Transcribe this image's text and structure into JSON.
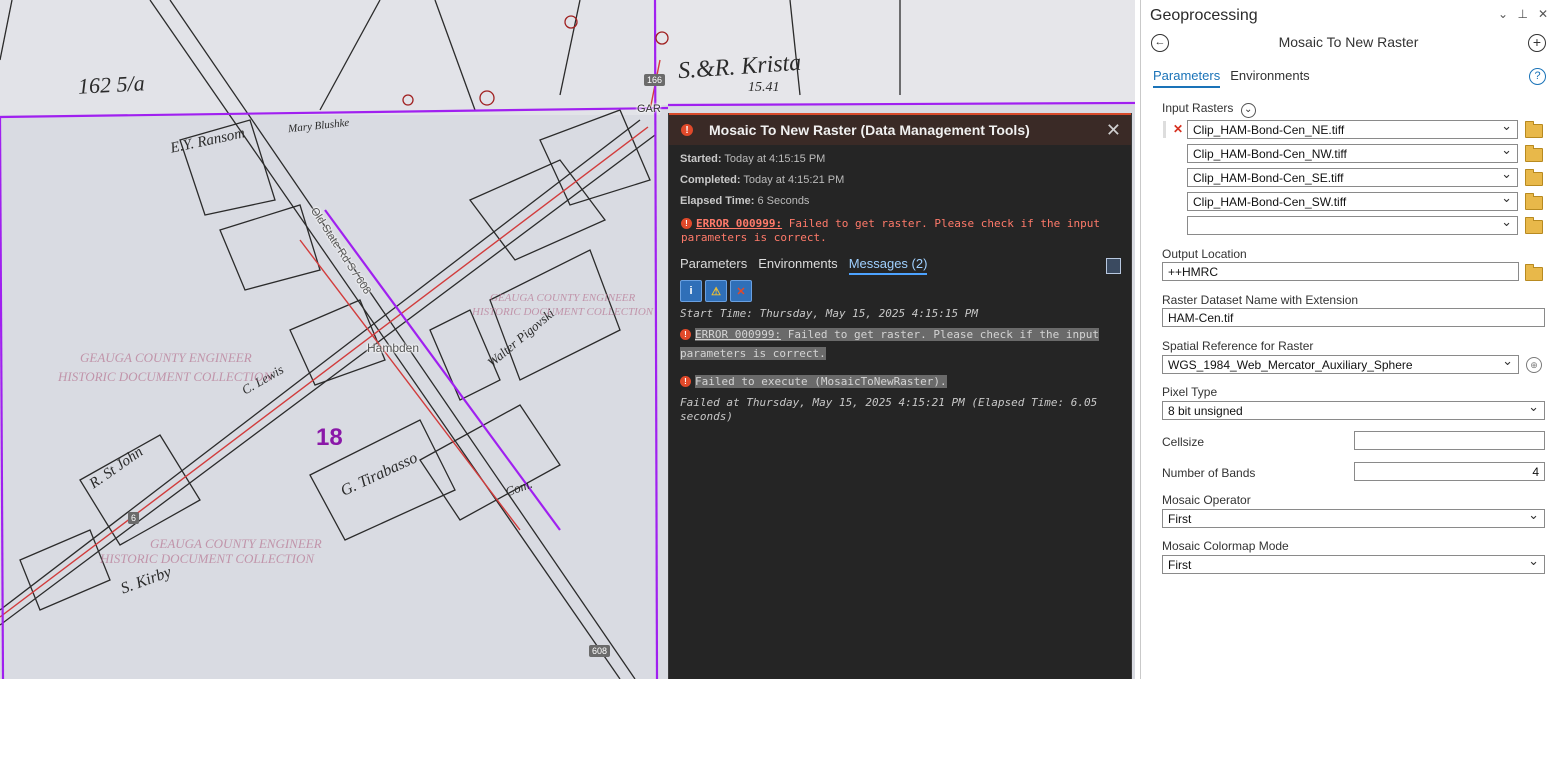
{
  "map": {
    "labels": {
      "hambden": "Hambden",
      "old_state_rd": "Old State Rd S / 608",
      "parcel_18": "18",
      "gar": "GAR"
    },
    "shields": {
      "r166": "166",
      "r608": "608",
      "r6": "6"
    },
    "watermarks": {
      "w1": "GEAUGA COUNTY ENGINEER",
      "w2": "HISTORIC DOCUMENT COLLECTION",
      "w3": "GEAUGA COUNTY ENGINEER",
      "w4": "HISTORIC DOCUMENT COLLECTION",
      "w5": "GEAUGA COUNTY ENGINEER",
      "w6": "HISTORIC DOCUMENT COLLECTION"
    },
    "handwriting": {
      "h1": "S.&R. Krista",
      "h2": "162 5/a",
      "h3": "E.Y. Ransom",
      "h4": "G. Tirabasso",
      "h5": "R. St John",
      "h6": "S. Kirby",
      "h7": "Walter Pigovski",
      "h8": "Mary Blushke",
      "h9": "15.41",
      "h10": "C. Lewis",
      "h11": "Com."
    }
  },
  "popup": {
    "title": "Mosaic To New Raster (Data Management Tools)",
    "started_label": "Started:",
    "started_value": "Today at 4:15:15 PM",
    "completed_label": "Completed:",
    "completed_value": "Today at 4:15:21 PM",
    "elapsed_label": "Elapsed Time:",
    "elapsed_value": "6 Seconds",
    "error_code": "ERROR 000999:",
    "error_text": "Failed to get raster. Please check if the input parameters is correct.",
    "tabs": [
      "Parameters",
      "Environments",
      "Messages (2)"
    ],
    "messages": {
      "start": "Start Time: Thursday, May 15, 2025 4:15:15 PM",
      "error_code": "ERROR 000999:",
      "error_text_1": "Failed to get raster. Please check if the input",
      "error_text_2": "parameters is correct.",
      "fail_exec": "Failed to execute (MosaicToNewRaster).",
      "failed_at_1": "Failed at Thursday, May 15, 2025 4:15:21 PM (Elapsed Time: 6.05",
      "failed_at_2": "seconds)"
    }
  },
  "geoprocessing": {
    "pane_title": "Geoprocessing",
    "tool_title": "Mosaic To New Raster",
    "tabs": [
      "Parameters",
      "Environments"
    ],
    "input_rasters_label": "Input Rasters",
    "input_rasters": [
      "Clip_HAM-Bond-Cen_NE.tiff",
      "Clip_HAM-Bond-Cen_NW.tiff",
      "Clip_HAM-Bond-Cen_SE.tiff",
      "Clip_HAM-Bond-Cen_SW.tiff",
      ""
    ],
    "output_location_label": "Output Location",
    "output_location": "++HMRC",
    "raster_name_label": "Raster Dataset Name with Extension",
    "raster_name": "HAM-Cen.tif",
    "spatial_ref_label": "Spatial Reference for  Raster",
    "spatial_ref": "WGS_1984_Web_Mercator_Auxiliary_Sphere",
    "pixel_type_label": "Pixel Type",
    "pixel_type": "8 bit unsigned",
    "cellsize_label": "Cellsize",
    "cellsize": "",
    "num_bands_label": "Number of Bands",
    "num_bands": "4",
    "mosaic_operator_label": "Mosaic Operator",
    "mosaic_operator": "First",
    "colormap_label": "Mosaic Colormap Mode",
    "colormap": "First"
  },
  "colors": {
    "error_red": "#e0492a",
    "accent_blue": "#1a73b8",
    "parcel_purple": "#a020f0",
    "road_red": "#d23c3c"
  }
}
